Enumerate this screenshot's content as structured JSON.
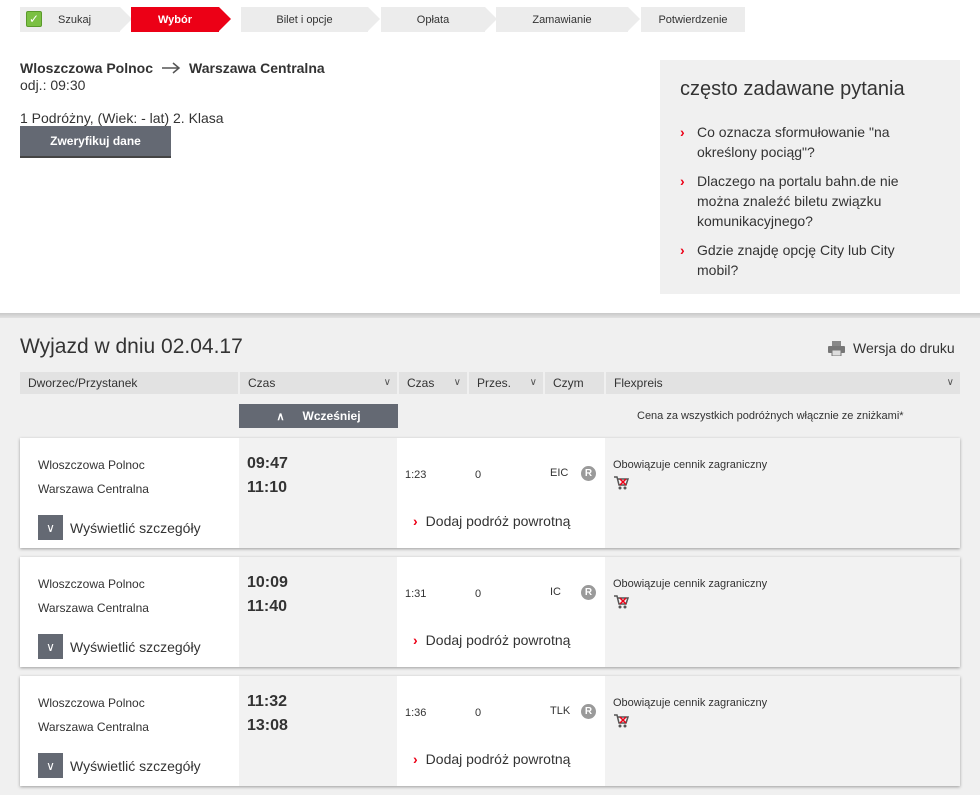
{
  "progress": {
    "steps": [
      "Szukaj",
      "Wybór",
      "Bilet i opcje",
      "Opłata",
      "Zamawianie",
      "Potwierdzenie"
    ]
  },
  "journey": {
    "from": "Wloszczowa Polnoc",
    "to": "Warszawa Centralna",
    "departure": "odj.: 09:30",
    "travellers": "1 Podróżny, (Wiek: - lat) 2. Klasa",
    "verify_button": "Zweryfikuj dane"
  },
  "faq": {
    "title": "często zadawane pytania",
    "items": [
      "Co oznacza sformułowanie \"na określony pociąg\"?",
      "Dlaczego na portalu bahn.de nie można znaleźć biletu związku komunikacyjnego?",
      "Gdzie znajdę opcję City lub City mobil?"
    ]
  },
  "results": {
    "heading": "Wyjazd w dniu 02.04.17",
    "print_label": "Wersja do druku",
    "columns": [
      "Dworzec/Przystanek",
      "Czas",
      "Czas",
      "Przes.",
      "Czym",
      "Flexpreis"
    ],
    "earlier_button": "Wcześniej",
    "price_note": "Cena za wszystkich podróżnych włącznie ze zniżkami*",
    "details_label": "Wyświetlić szczegóły",
    "return_label": "Dodaj podróż powrotną",
    "price_text": "Obowiązuje cennik zagraniczny",
    "reservation_badge": "R",
    "connections": [
      {
        "from": "Wloszczowa Polnoc",
        "to": "Warszawa Centralna",
        "dep": "09:47",
        "arr": "11:10",
        "duration": "1:23",
        "changes": "0",
        "product": "EIC"
      },
      {
        "from": "Wloszczowa Polnoc",
        "to": "Warszawa Centralna",
        "dep": "10:09",
        "arr": "11:40",
        "duration": "1:31",
        "changes": "0",
        "product": "IC"
      },
      {
        "from": "Wloszczowa Polnoc",
        "to": "Warszawa Centralna",
        "dep": "11:32",
        "arr": "13:08",
        "duration": "1:36",
        "changes": "0",
        "product": "TLK"
      }
    ]
  },
  "colors": {
    "accent": "#ec0016",
    "button_grey": "#646973",
    "panel_bg": "#f0f0f0"
  },
  "icons": {
    "step_done": "checkmark-icon",
    "print": "printer-icon",
    "cart": "cart-icon",
    "expand": "chevron-down-icon",
    "earlier": "chevron-up-icon"
  }
}
